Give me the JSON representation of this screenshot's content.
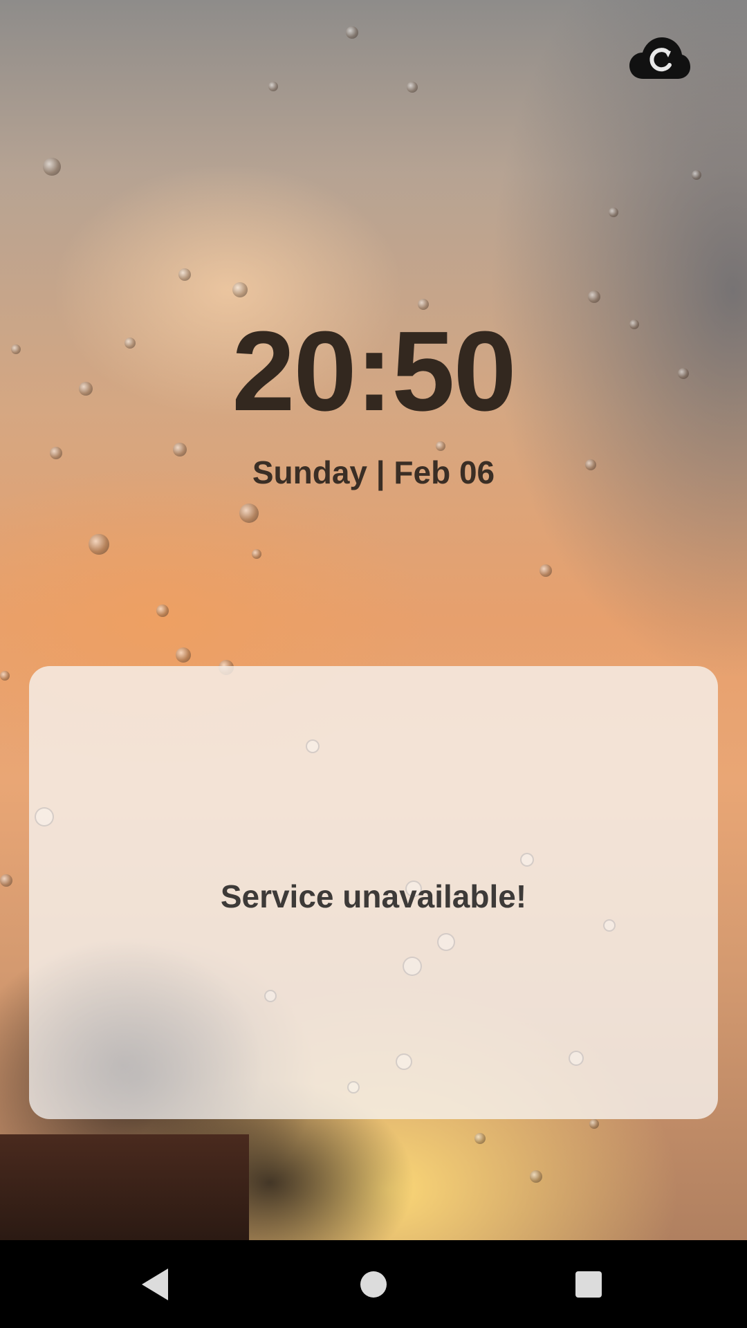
{
  "lockscreen": {
    "time": "20:50",
    "date": "Sunday | Feb 06"
  },
  "card": {
    "message": "Service unavailable!"
  },
  "icons": {
    "top_right": "cloud-sync-icon",
    "nav_back": "back-triangle-icon",
    "nav_home": "home-circle-icon",
    "nav_recents": "recents-square-icon"
  },
  "colors": {
    "clock_text": "#33281f",
    "message_text": "#3d3a38",
    "navbar": "#000000",
    "nav_buttons": "#dcdcdc"
  }
}
